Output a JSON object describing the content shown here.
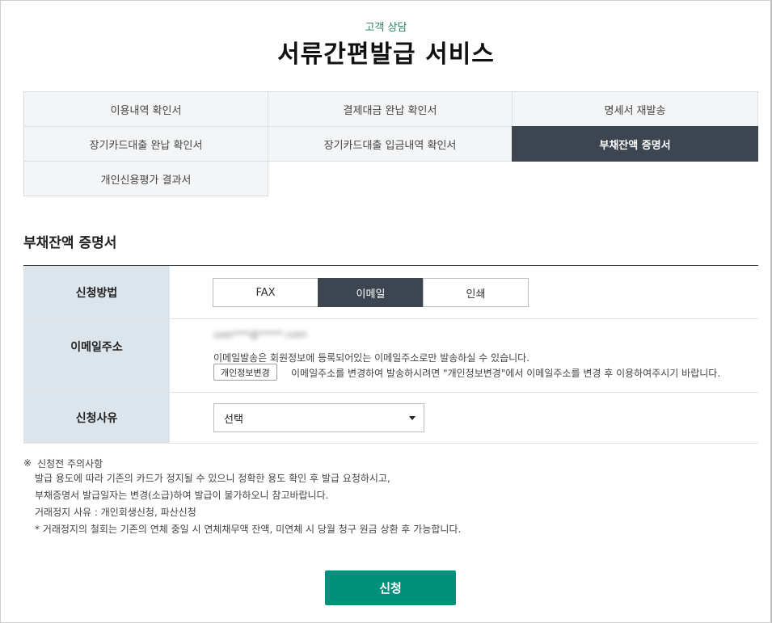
{
  "header": {
    "eyebrow": "고객 상담",
    "title": "서류간편발급 서비스"
  },
  "tabs": [
    {
      "label": "이용내역 확인서",
      "active": false
    },
    {
      "label": "결제대금 완납 확인서",
      "active": false
    },
    {
      "label": "명세서 재발송",
      "active": false
    },
    {
      "label": "장기카드대출 완납 확인서",
      "active": false
    },
    {
      "label": "장기카드대출 입금내역 확인서",
      "active": false
    },
    {
      "label": "부채잔액 증명서",
      "active": true
    },
    {
      "label": "개인신용평가 결과서",
      "active": false
    }
  ],
  "section": {
    "title": "부채잔액 증명서"
  },
  "form": {
    "method": {
      "label": "신청방법",
      "options": [
        "FAX",
        "이메일",
        "인쇄"
      ],
      "selected": "이메일"
    },
    "email": {
      "label": "이메일주소",
      "value_masked": "user***@*****.com",
      "note": "이메일발송은 회원정보에 등록되어있는 이메일주소로만 발송하실 수 있습니다.",
      "profile_button": "개인정보변경",
      "profile_note": "이메일주소를 변경하여 발송하시려면 \"개인정보변경\"에서 이메일주소를 변경 후 이용하여주시기 바랍니다."
    },
    "reason": {
      "label": "신청사유",
      "selected": "선택"
    }
  },
  "notice": {
    "mark": "※",
    "title": "신청전 주의사항",
    "lines": [
      "발급 용도에 따라 기존의 카드가 정지될 수 있으니 정확한 용도 확인 후 발급 요청하시고,",
      "부채증명서 발급일자는 변경(소급)하여 발급이 불가하오니 참고바랍니다.",
      "거래정지 사유 : 개인회생신청, 파산신청",
      "* 거래정지의 철회는 기존의 연체 중일 시 연체채무액 잔액, 미연체 시 당월 청구 원금 상환 후 가능합니다."
    ]
  },
  "submit_label": "신청",
  "colors": {
    "accent": "#00917a",
    "tab_active": "#3d4550",
    "label_bg": "#dde5ec"
  }
}
